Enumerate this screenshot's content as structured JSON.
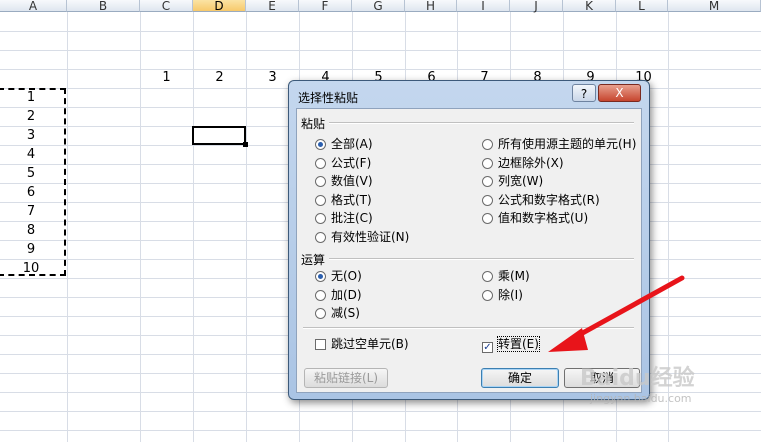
{
  "sheet": {
    "columns": [
      "A",
      "B",
      "C",
      "D",
      "E",
      "F",
      "G",
      "H",
      "I",
      "J",
      "K",
      "L",
      "M"
    ],
    "selected_column": "D",
    "row_values": [
      "1",
      "2",
      "3",
      "4",
      "5",
      "6",
      "7",
      "8",
      "9",
      "10"
    ],
    "col_values": [
      "1",
      "2",
      "3",
      "4",
      "5",
      "6",
      "7",
      "8",
      "9",
      "10"
    ]
  },
  "dialog": {
    "title": "选择性粘贴",
    "help": "?",
    "close": "X",
    "paste_group": "粘贴",
    "paste_left": [
      {
        "label": "全部(A)",
        "checked": true
      },
      {
        "label": "公式(F)",
        "checked": false
      },
      {
        "label": "数值(V)",
        "checked": false
      },
      {
        "label": "格式(T)",
        "checked": false
      },
      {
        "label": "批注(C)",
        "checked": false
      },
      {
        "label": "有效性验证(N)",
        "checked": false
      }
    ],
    "paste_right": [
      {
        "label": "所有使用源主题的单元(H)",
        "checked": false
      },
      {
        "label": "边框除外(X)",
        "checked": false
      },
      {
        "label": "列宽(W)",
        "checked": false
      },
      {
        "label": "公式和数字格式(R)",
        "checked": false
      },
      {
        "label": "值和数字格式(U)",
        "checked": false
      }
    ],
    "op_group": "运算",
    "op_left": [
      {
        "label": "无(O)",
        "checked": true
      },
      {
        "label": "加(D)",
        "checked": false
      },
      {
        "label": "减(S)",
        "checked": false
      }
    ],
    "op_right": [
      {
        "label": "乘(M)",
        "checked": false
      },
      {
        "label": "除(I)",
        "checked": false
      }
    ],
    "skip_blanks": {
      "label": "跳过空单元(B)",
      "checked": false
    },
    "transpose": {
      "label": "转置(E)",
      "checked": true
    },
    "paste_link": "粘贴链接(L)",
    "ok": "确定",
    "cancel": "取消"
  },
  "watermark": {
    "brand": "Baidu经验",
    "url": "jingyan.baidu.com"
  },
  "colors": {
    "arrow": "#e8141a",
    "selected_header": "#f7c96b"
  }
}
